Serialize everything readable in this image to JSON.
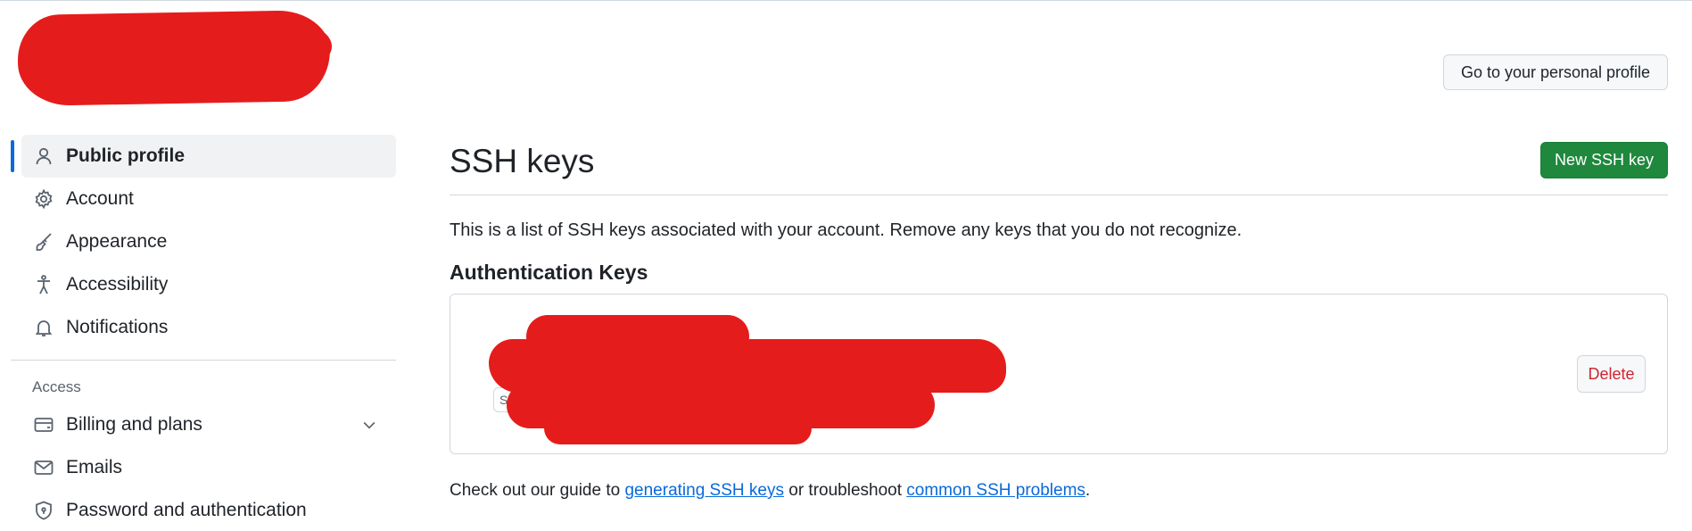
{
  "header": {
    "profile_button": "Go to your personal profile"
  },
  "sidebar": {
    "items": [
      {
        "label": "Public profile",
        "icon": "person-icon",
        "active": true
      },
      {
        "label": "Account",
        "icon": "gear-icon"
      },
      {
        "label": "Appearance",
        "icon": "paintbrush-icon"
      },
      {
        "label": "Accessibility",
        "icon": "accessibility-icon"
      },
      {
        "label": "Notifications",
        "icon": "bell-icon"
      }
    ],
    "access_section_label": "Access",
    "access_items": [
      {
        "label": "Billing and plans",
        "icon": "credit-card-icon",
        "expandable": true
      },
      {
        "label": "Emails",
        "icon": "mail-icon"
      },
      {
        "label": "Password and authentication",
        "icon": "shield-lock-icon"
      }
    ]
  },
  "main": {
    "title": "SSH keys",
    "new_key_button": "New SSH key",
    "description": "This is a list of SSH keys associated with your account. Remove any keys that you do not recognize.",
    "auth_keys_heading": "Authentication Keys",
    "key_badge": "S",
    "delete_button": "Delete",
    "guide_prefix": "Check out our guide to ",
    "guide_link_1": "generating SSH keys",
    "guide_middle": " or troubleshoot ",
    "guide_link_2": "common SSH problems",
    "guide_suffix": "."
  },
  "colors": {
    "accent": "#0969da",
    "primary_button": "#1f883d",
    "danger": "#d1242f",
    "redaction": "#e51c1c"
  }
}
